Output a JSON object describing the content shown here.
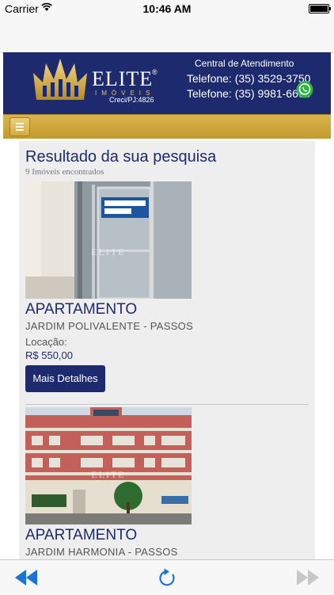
{
  "status_bar": {
    "carrier": "Carrier",
    "time": "10:46 AM"
  },
  "header": {
    "logo_name": "ELITE",
    "logo_registered": "®",
    "logo_sub": "IMÓVEIS",
    "creci": "Creci/PJ:4826",
    "central": "Central de Atendimento",
    "phone1": "Telefone: (35) 3529-3750",
    "phone2": "Telefone: (35) 9981-6666"
  },
  "results": {
    "title": "Resultado da sua pesquisa",
    "count": "9 Imóveis encontrados",
    "listings": [
      {
        "type": "APARTAMENTO",
        "location": "JARDIM POLIVALENTE - PASSOS",
        "price_label": "Locação:",
        "price": "R$ 550,00",
        "details_label": "Mais Detalhes",
        "watermark": "ELITE"
      },
      {
        "type": "APARTAMENTO",
        "location": "JARDIM HARMONIA - PASSOS",
        "watermark": "ELITE"
      }
    ]
  },
  "colors": {
    "brand_navy": "#1d2a6e",
    "brand_gold": "#c9a13a"
  },
  "icons": {
    "menu": "hamburger-icon",
    "whatsapp": "whatsapp-icon",
    "back": "rewind-icon",
    "reload": "reload-icon",
    "forward": "fast-forward-icon"
  }
}
